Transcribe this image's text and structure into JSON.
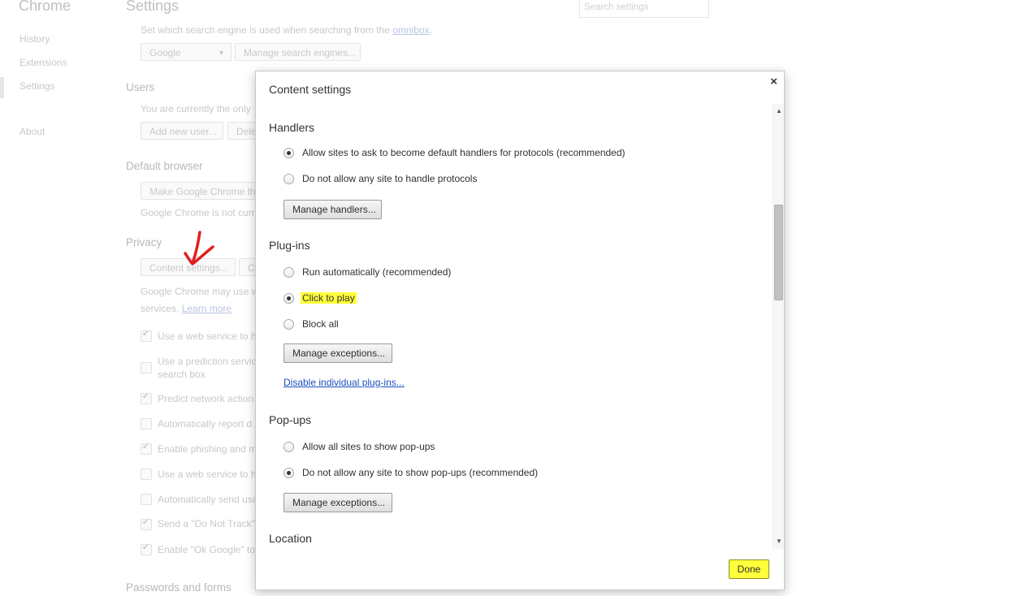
{
  "sidebar": {
    "brand": "Chrome",
    "items": [
      {
        "label": "History"
      },
      {
        "label": "Extensions"
      },
      {
        "label": "Settings"
      },
      {
        "label": "About"
      }
    ]
  },
  "settings": {
    "title": "Settings",
    "search_placeholder": "Search settings",
    "search_engine_text": "Set which search engine is used when searching from the",
    "search_engine_link": "omnibox",
    "search_engine_value": "Google",
    "manage_search_engines": "Manage search engines...",
    "users_heading": "Users",
    "users_text": "You are currently the only",
    "add_user": "Add new user...",
    "delete_user": "Dele",
    "default_browser_heading": "Default browser",
    "make_default": "Make Google Chrome th",
    "default_status": "Google Chrome is not curr",
    "privacy_heading": "Privacy",
    "content_settings": "Content settings...",
    "clear_browsing": "C",
    "privacy_text_1": "Google Chrome may use w",
    "privacy_text_2": "services.",
    "learn_more": "Learn more",
    "privacy_options": [
      {
        "label": "Use a web service to he",
        "checked": true
      },
      {
        "label": "Use a prediction servic",
        "label2": "search box",
        "checked": false
      },
      {
        "label": "Predict network action",
        "checked": true
      },
      {
        "label": "Automatically report d",
        "checked": false
      },
      {
        "label": "Enable phishing and m",
        "checked": true
      },
      {
        "label": "Use a web service to he",
        "checked": false
      },
      {
        "label": "Automatically send usa",
        "checked": false
      },
      {
        "label": "Send a \"Do Not Track\"",
        "checked": true
      },
      {
        "label": "Enable \"Ok Google\" to",
        "checked": true
      }
    ],
    "passwords_heading": "Passwords and forms"
  },
  "dialog": {
    "title": "Content settings",
    "close": "×",
    "handlers": {
      "heading": "Handlers",
      "options": [
        {
          "label": "Allow sites to ask to become default handlers for protocols (recommended)",
          "selected": true
        },
        {
          "label": "Do not allow any site to handle protocols",
          "selected": false
        }
      ],
      "button": "Manage handlers..."
    },
    "plugins": {
      "heading": "Plug-ins",
      "options": [
        {
          "label": "Run automatically (recommended)",
          "selected": false
        },
        {
          "label": "Click to play",
          "selected": true
        },
        {
          "label": "Block all",
          "selected": false
        }
      ],
      "button": "Manage exceptions...",
      "link": "Disable individual plug-ins..."
    },
    "popups": {
      "heading": "Pop-ups",
      "options": [
        {
          "label": "Allow all sites to show pop-ups",
          "selected": false
        },
        {
          "label": "Do not allow any site to show pop-ups (recommended)",
          "selected": true
        }
      ],
      "button": "Manage exceptions..."
    },
    "location": {
      "heading": "Location"
    },
    "done": "Done"
  },
  "colors": {
    "highlight": "#ffff3a",
    "annotation_arrow": "#e02020",
    "link": "#1a4fbf"
  }
}
